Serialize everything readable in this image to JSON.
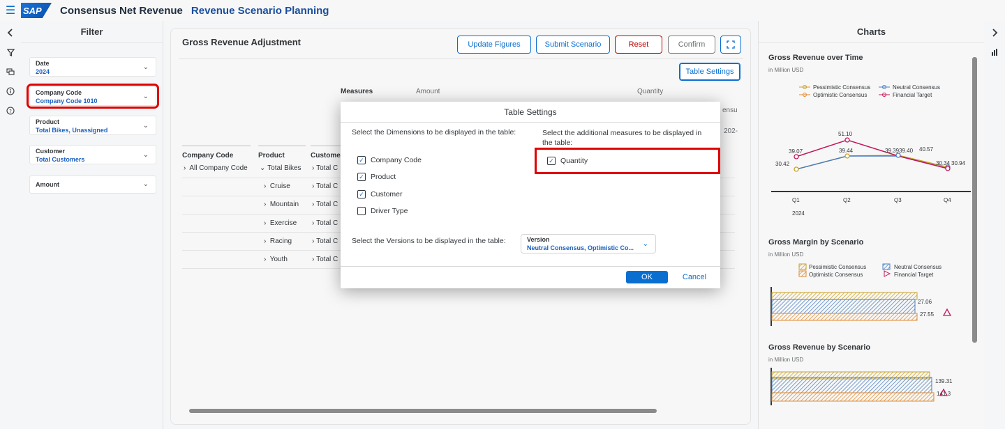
{
  "header": {
    "logo_text": "SAP",
    "app_title": "Consensus Net Revenue",
    "app_subtitle": "Revenue Scenario Planning"
  },
  "filter": {
    "title": "Filter",
    "items": [
      {
        "label": "Date",
        "value": "2024"
      },
      {
        "label": "Company Code",
        "value": "Company Code 1010"
      },
      {
        "label": "Product",
        "value": "Total Bikes, Unassigned"
      },
      {
        "label": "Customer",
        "value": "Total Customers"
      },
      {
        "label": "Amount",
        "value": ""
      }
    ]
  },
  "main": {
    "title": "Gross Revenue Adjustment",
    "buttons": {
      "update": "Update Figures",
      "submit": "Submit Scenario",
      "reset": "Reset",
      "confirm": "Confirm",
      "table_settings": "Table Settings"
    },
    "measures_label": "Measures",
    "amount_label": "Amount",
    "quantity_label": "Quantity",
    "partial_right_1": "ensu",
    "partial_right_2": "202-",
    "columns": [
      "Company Code",
      "Product",
      "Custome"
    ],
    "rows": [
      {
        "company": "All Company Code",
        "product": "Total Bikes",
        "customer": "Total C"
      },
      {
        "company": "",
        "product": "Cruise",
        "customer": "Total C"
      },
      {
        "company": "",
        "product": "Mountain",
        "customer": "Total C"
      },
      {
        "company": "",
        "product": "Exercise",
        "customer": "Total C"
      },
      {
        "company": "",
        "product": "Racing",
        "customer": "Total C"
      },
      {
        "company": "",
        "product": "Youth",
        "customer": "Total C"
      }
    ]
  },
  "charts": {
    "title": "Charts",
    "chart1": {
      "title": "Gross Revenue over Time",
      "subtitle": "in Million USD",
      "legend": [
        "Pessimistic Consensus",
        "Neutral Consensus",
        "Optimistic Consensus",
        "Financial Target"
      ],
      "quarters": [
        "Q1",
        "Q2",
        "Q3",
        "Q4"
      ],
      "year": "2024",
      "labels_top": [
        "39.07",
        "51.10",
        "39.44",
        "39.39",
        "39.40",
        "40.57",
        "30.34",
        "30.94"
      ],
      "label_q1_low": "30.42",
      "label_q4_right": "30.94"
    },
    "chart2": {
      "title": "Gross Margin by Scenario",
      "subtitle": "in Million USD",
      "legend": [
        "Pessimistic Consensus",
        "Neutral Consensus",
        "Optimistic Consensus",
        "Financial Target"
      ],
      "value_a": "27.06",
      "value_b": "27.55"
    },
    "chart3": {
      "title": "Gross Revenue by Scenario",
      "subtitle": "in Million USD",
      "value_a": "139.31",
      "value_b": "141.3"
    }
  },
  "dialog": {
    "title": "Table Settings",
    "dimensions_prompt": "Select the Dimensions to be displayed in the table:",
    "measures_prompt": "Select the additional measures to be displayed in the table:",
    "dimensions": [
      {
        "label": "Company Code",
        "checked": true
      },
      {
        "label": "Product",
        "checked": true
      },
      {
        "label": "Customer",
        "checked": true
      },
      {
        "label": "Driver Type",
        "checked": false
      }
    ],
    "measures": [
      {
        "label": "Quantity",
        "checked": true
      }
    ],
    "versions_prompt": "Select the Versions to be displayed in the table:",
    "version_label": "Version",
    "version_value": "Neutral Consensus, Optimistic Co...",
    "ok": "OK",
    "cancel": "Cancel"
  },
  "colors": {
    "accent": "#0a6ed1",
    "highlight": "#e00000",
    "pessimistic": "#c9a227",
    "neutral": "#4a7fc1",
    "optimistic": "#e08a2e",
    "target": "#c2185b"
  }
}
